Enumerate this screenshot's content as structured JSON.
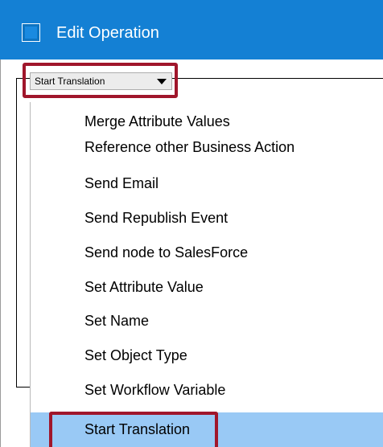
{
  "window": {
    "title": "Edit Operation"
  },
  "operation_combo": {
    "selected": "Start Translation"
  },
  "dropdown": {
    "items": [
      {
        "label": "Merge Attribute Values",
        "selected": false
      },
      {
        "label": "Reference other Business Action",
        "selected": false
      },
      {
        "label": "Send Email",
        "selected": false
      },
      {
        "label": "Send Republish Event",
        "selected": false
      },
      {
        "label": "Send node to SalesForce",
        "selected": false
      },
      {
        "label": "Set Attribute Value",
        "selected": false
      },
      {
        "label": "Set Name",
        "selected": false
      },
      {
        "label": "Set Object Type",
        "selected": false
      },
      {
        "label": "Set Workflow Variable",
        "selected": false
      },
      {
        "label": "Start Translation",
        "selected": true
      }
    ]
  },
  "colors": {
    "titlebar": "#1480d4",
    "selection": "#99c9f5",
    "callout": "#a0162b"
  }
}
